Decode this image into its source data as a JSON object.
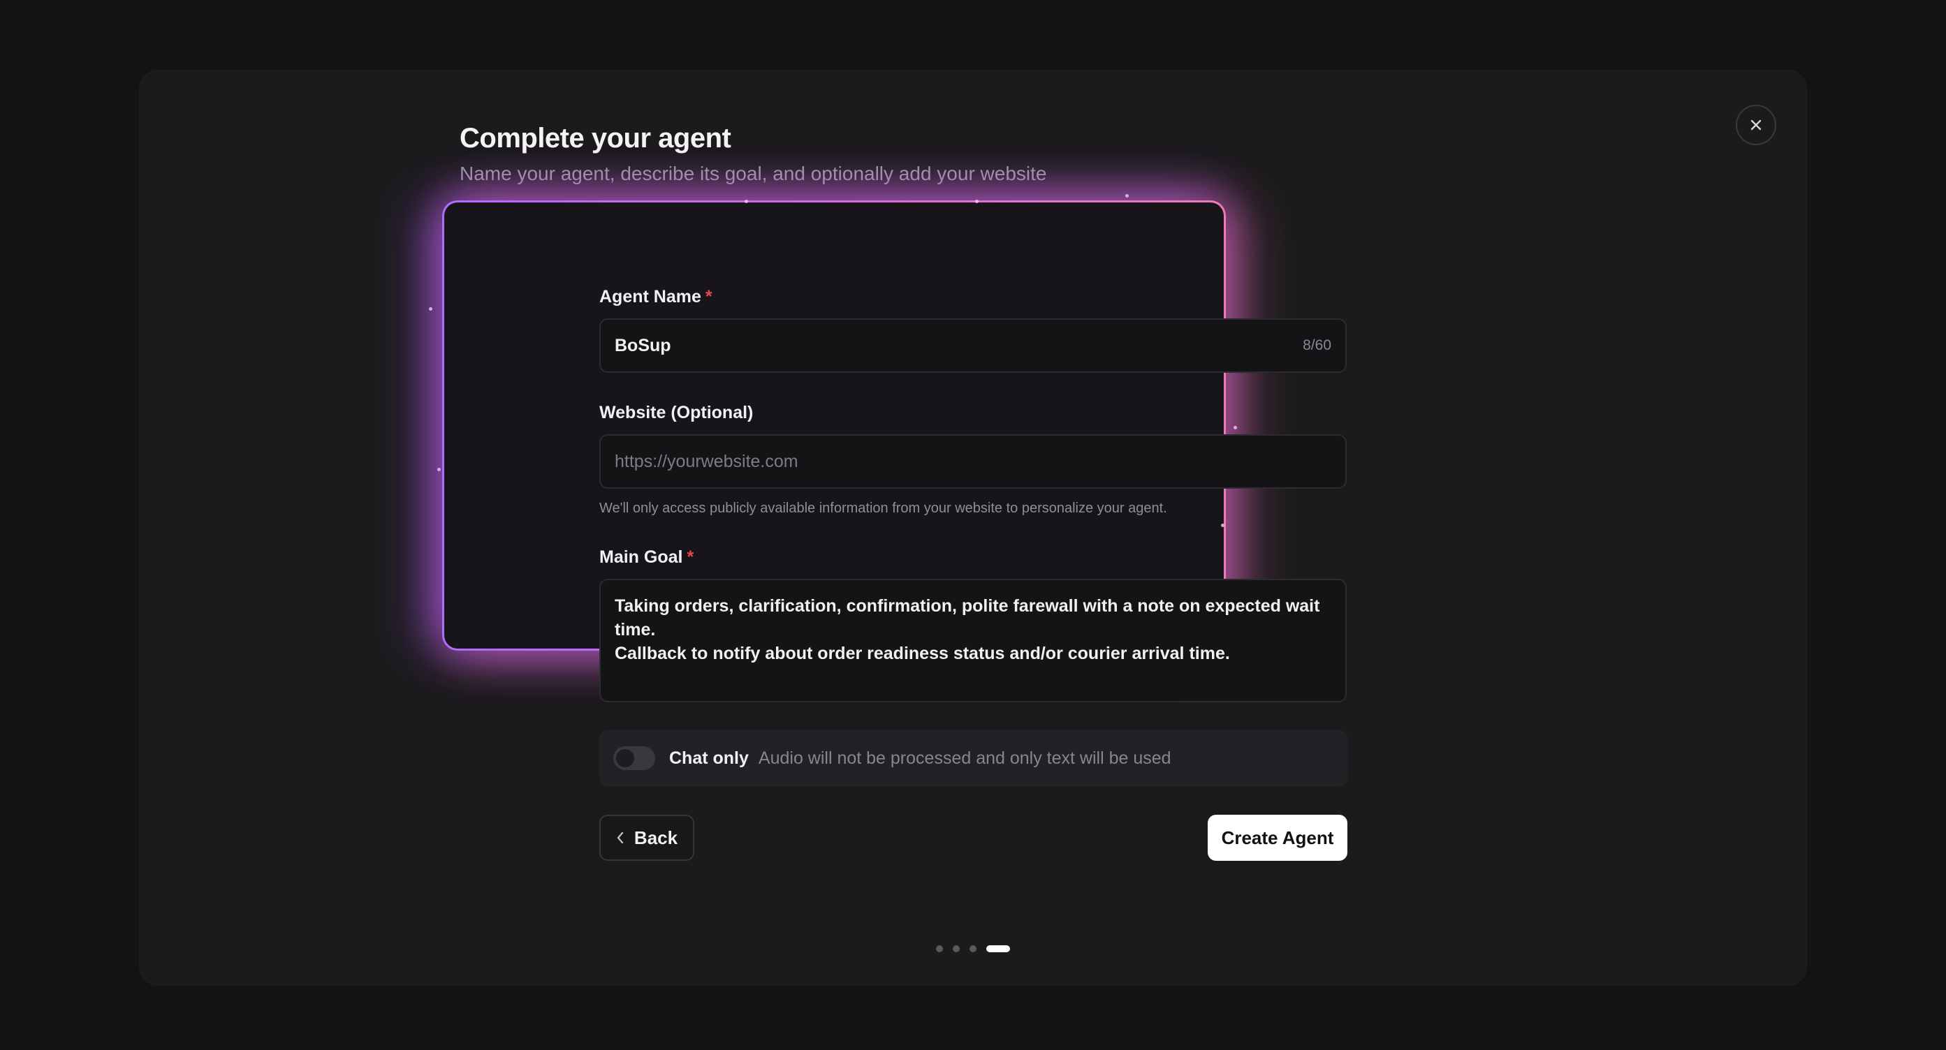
{
  "dialog": {
    "title": "Complete your agent",
    "subtitle": "Name your agent, describe its goal, and optionally add your website",
    "close_icon": "close-icon"
  },
  "form": {
    "agent_name": {
      "label": "Agent Name",
      "required_mark": "*",
      "value": "BoSup",
      "counter": "8/60"
    },
    "website": {
      "label": "Website (Optional)",
      "placeholder": "https://yourwebsite.com",
      "hint": "We'll only access publicly available information from your website to personalize your agent."
    },
    "main_goal": {
      "label": "Main Goal",
      "required_mark": "*",
      "value_line1": "Taking orders, clarification, confirmation, polite farewall with a note on expected wait time.",
      "value_line2": "Callback to notify about order readiness status and/or courier arrival time."
    },
    "chat_only": {
      "label": "Chat only",
      "description": "Audio will not be processed and only text will be used",
      "enabled": false
    }
  },
  "actions": {
    "back_label": "Back",
    "back_icon": "chevron-left-icon",
    "create_label": "Create Agent"
  },
  "pager": {
    "total_steps": 4,
    "current_step": 4
  },
  "colors": {
    "glow_left": "#b06cff",
    "glow_right": "#f07ab6",
    "required": "#e5484d",
    "background": "#131314",
    "modal": "#1b1b1c"
  }
}
